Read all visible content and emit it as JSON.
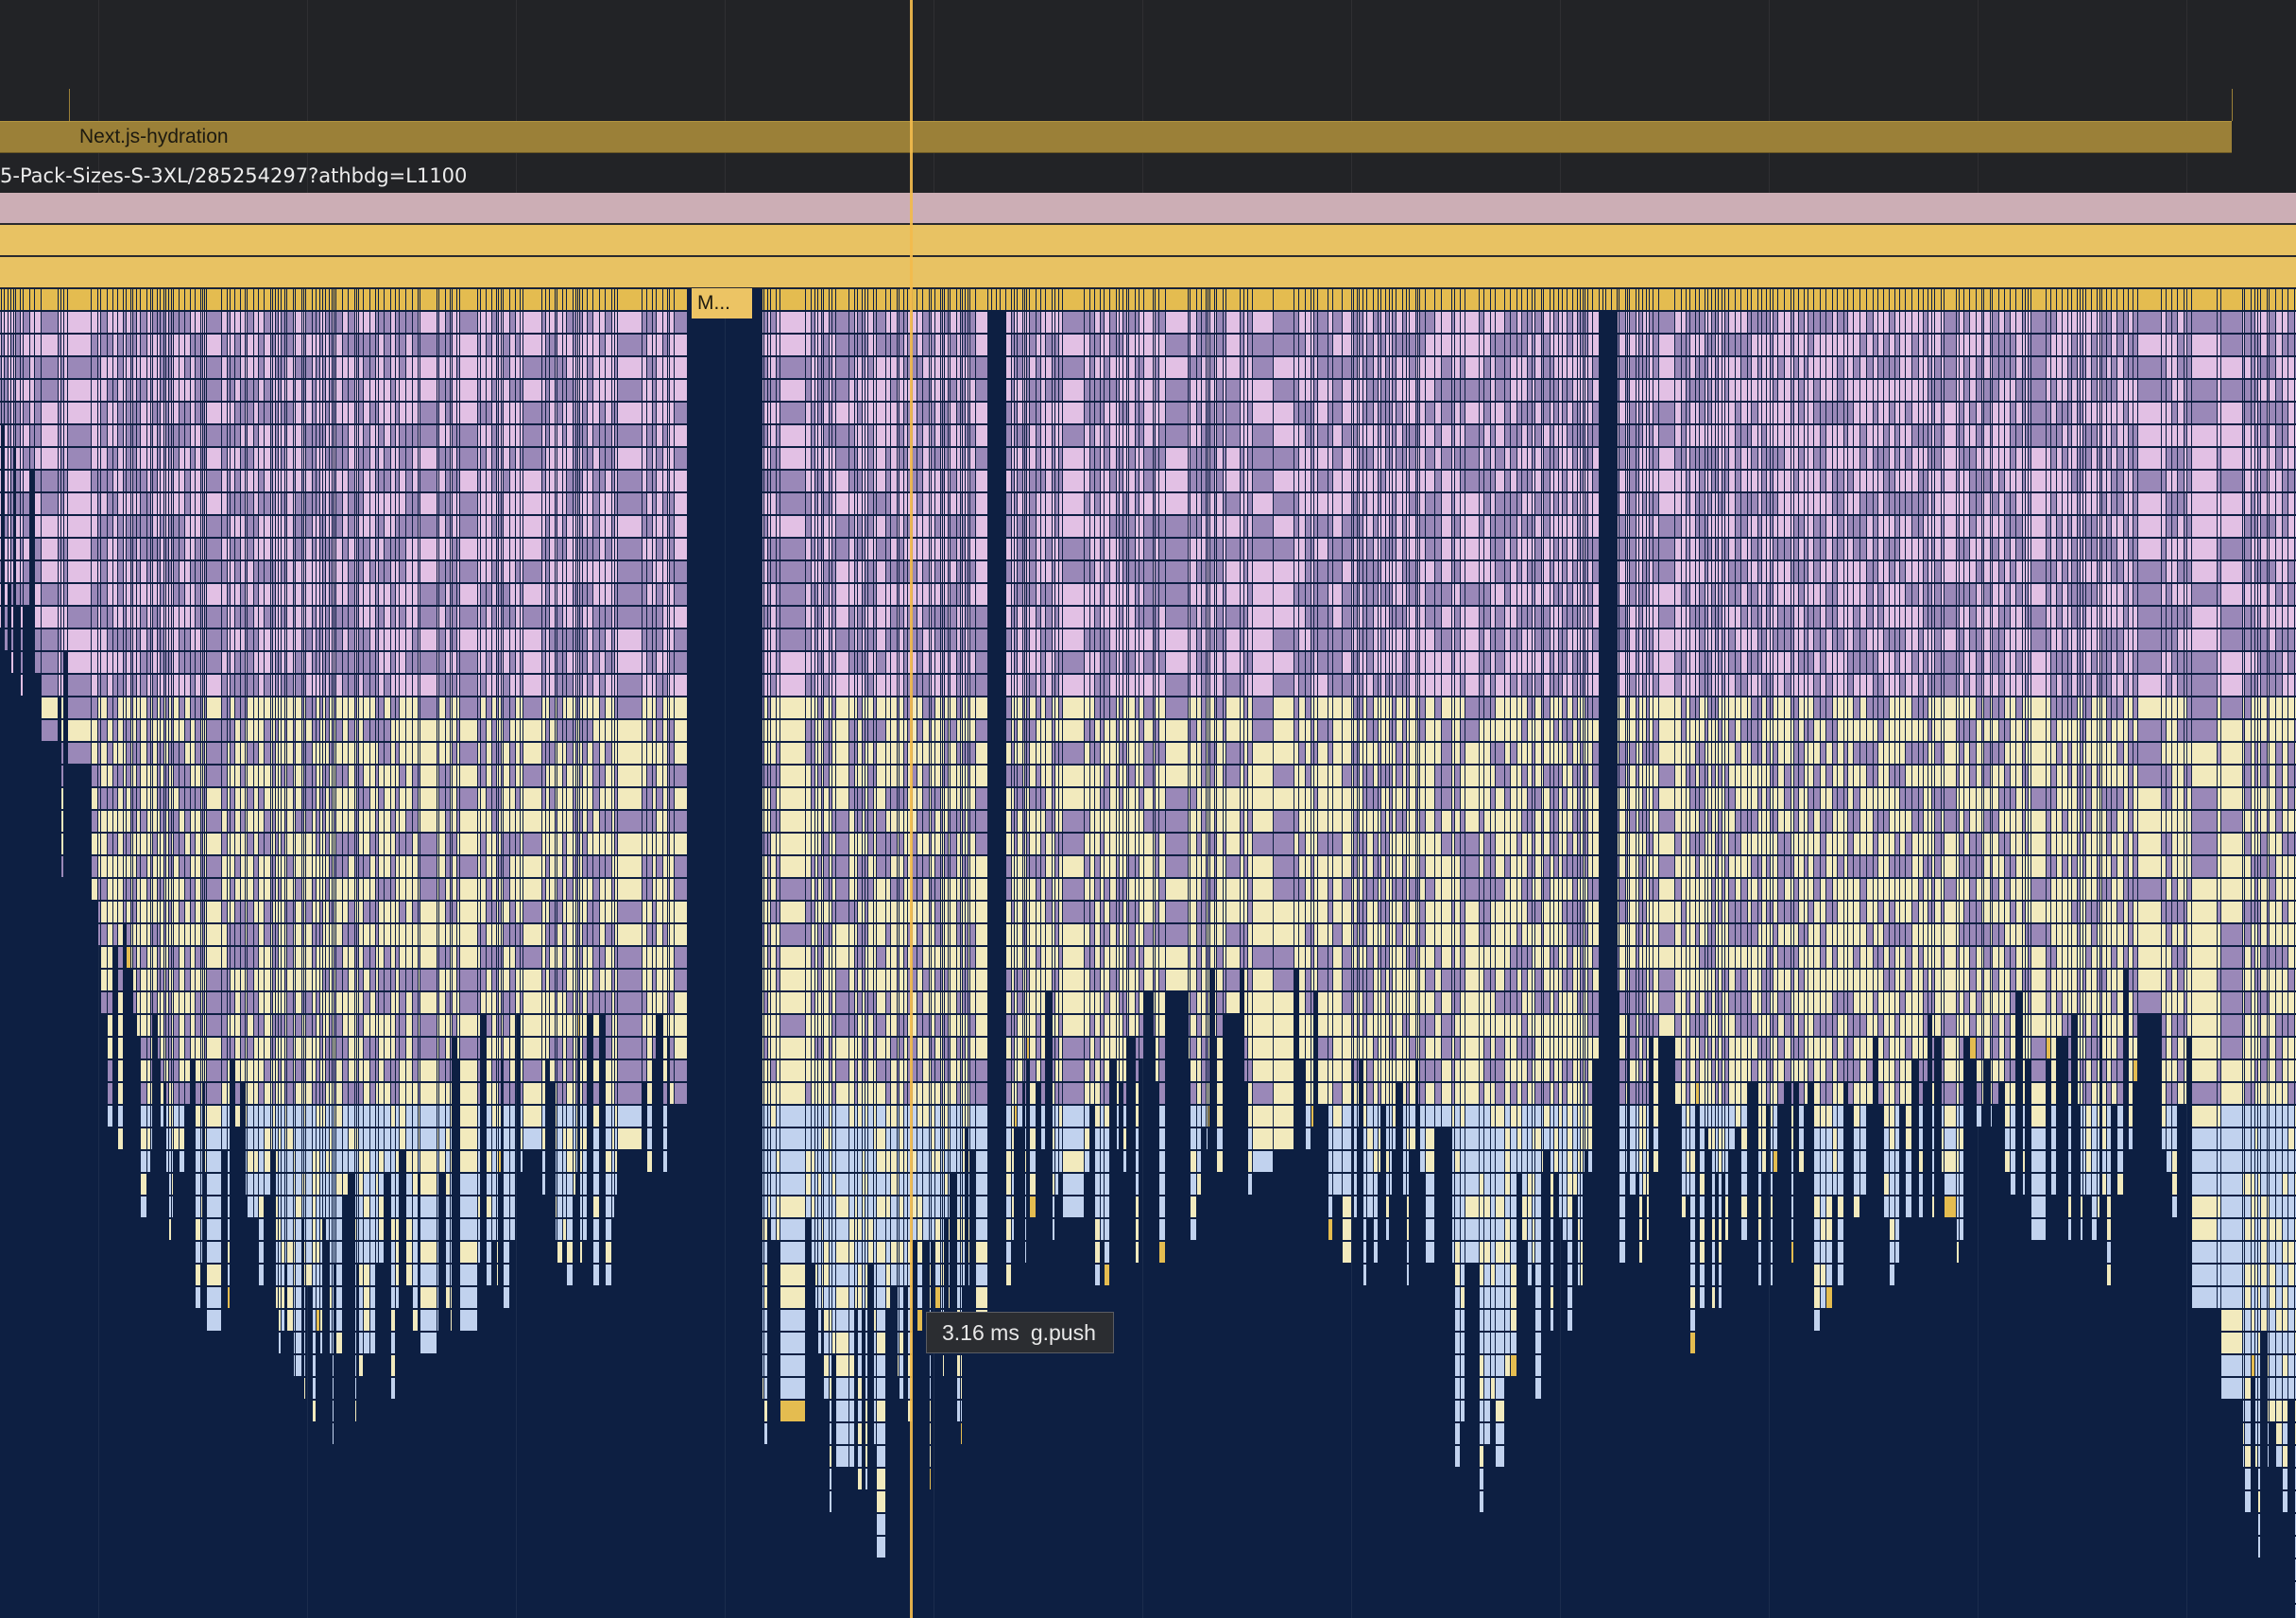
{
  "timeline": {
    "timing_bar_label": "Next.js-hydration",
    "url_label": "5-Pack-Sizes-S-3XL/285254297?athbdg=L1100",
    "truncated_frame_label": "M...",
    "tooltip": {
      "duration": "3.16 ms",
      "function_name": "g.push"
    },
    "colors": {
      "background": "#0d1f42",
      "header": "#222326",
      "timing_bar": "#9b8038",
      "task_track": "#ccaeb5",
      "script_track": "#e8c263",
      "flame_pink": "#e2c0e4",
      "flame_purple": "#9a88b8",
      "flame_cream": "#f2eabd",
      "flame_blue": "#c1d2ee",
      "flame_gold": "#e4bc50",
      "cursor": "#f2bb4c"
    }
  }
}
